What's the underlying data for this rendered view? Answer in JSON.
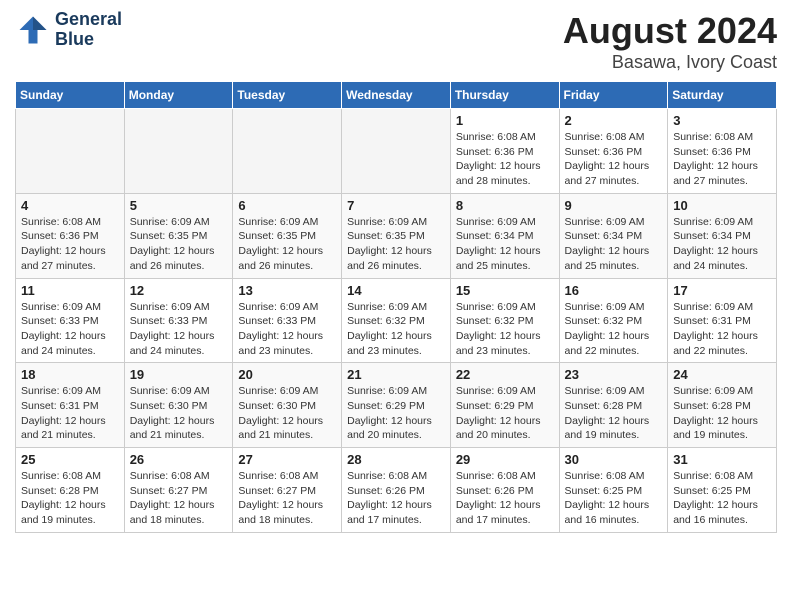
{
  "header": {
    "logo_line1": "General",
    "logo_line2": "Blue",
    "main_title": "August 2024",
    "subtitle": "Basawa, Ivory Coast"
  },
  "calendar": {
    "days_of_week": [
      "Sunday",
      "Monday",
      "Tuesday",
      "Wednesday",
      "Thursday",
      "Friday",
      "Saturday"
    ],
    "weeks": [
      [
        {
          "day": "",
          "info": ""
        },
        {
          "day": "",
          "info": ""
        },
        {
          "day": "",
          "info": ""
        },
        {
          "day": "",
          "info": ""
        },
        {
          "day": "1",
          "info": "Sunrise: 6:08 AM\nSunset: 6:36 PM\nDaylight: 12 hours\nand 28 minutes."
        },
        {
          "day": "2",
          "info": "Sunrise: 6:08 AM\nSunset: 6:36 PM\nDaylight: 12 hours\nand 27 minutes."
        },
        {
          "day": "3",
          "info": "Sunrise: 6:08 AM\nSunset: 6:36 PM\nDaylight: 12 hours\nand 27 minutes."
        }
      ],
      [
        {
          "day": "4",
          "info": "Sunrise: 6:08 AM\nSunset: 6:36 PM\nDaylight: 12 hours\nand 27 minutes."
        },
        {
          "day": "5",
          "info": "Sunrise: 6:09 AM\nSunset: 6:35 PM\nDaylight: 12 hours\nand 26 minutes."
        },
        {
          "day": "6",
          "info": "Sunrise: 6:09 AM\nSunset: 6:35 PM\nDaylight: 12 hours\nand 26 minutes."
        },
        {
          "day": "7",
          "info": "Sunrise: 6:09 AM\nSunset: 6:35 PM\nDaylight: 12 hours\nand 26 minutes."
        },
        {
          "day": "8",
          "info": "Sunrise: 6:09 AM\nSunset: 6:34 PM\nDaylight: 12 hours\nand 25 minutes."
        },
        {
          "day": "9",
          "info": "Sunrise: 6:09 AM\nSunset: 6:34 PM\nDaylight: 12 hours\nand 25 minutes."
        },
        {
          "day": "10",
          "info": "Sunrise: 6:09 AM\nSunset: 6:34 PM\nDaylight: 12 hours\nand 24 minutes."
        }
      ],
      [
        {
          "day": "11",
          "info": "Sunrise: 6:09 AM\nSunset: 6:33 PM\nDaylight: 12 hours\nand 24 minutes."
        },
        {
          "day": "12",
          "info": "Sunrise: 6:09 AM\nSunset: 6:33 PM\nDaylight: 12 hours\nand 24 minutes."
        },
        {
          "day": "13",
          "info": "Sunrise: 6:09 AM\nSunset: 6:33 PM\nDaylight: 12 hours\nand 23 minutes."
        },
        {
          "day": "14",
          "info": "Sunrise: 6:09 AM\nSunset: 6:32 PM\nDaylight: 12 hours\nand 23 minutes."
        },
        {
          "day": "15",
          "info": "Sunrise: 6:09 AM\nSunset: 6:32 PM\nDaylight: 12 hours\nand 23 minutes."
        },
        {
          "day": "16",
          "info": "Sunrise: 6:09 AM\nSunset: 6:32 PM\nDaylight: 12 hours\nand 22 minutes."
        },
        {
          "day": "17",
          "info": "Sunrise: 6:09 AM\nSunset: 6:31 PM\nDaylight: 12 hours\nand 22 minutes."
        }
      ],
      [
        {
          "day": "18",
          "info": "Sunrise: 6:09 AM\nSunset: 6:31 PM\nDaylight: 12 hours\nand 21 minutes."
        },
        {
          "day": "19",
          "info": "Sunrise: 6:09 AM\nSunset: 6:30 PM\nDaylight: 12 hours\nand 21 minutes."
        },
        {
          "day": "20",
          "info": "Sunrise: 6:09 AM\nSunset: 6:30 PM\nDaylight: 12 hours\nand 21 minutes."
        },
        {
          "day": "21",
          "info": "Sunrise: 6:09 AM\nSunset: 6:29 PM\nDaylight: 12 hours\nand 20 minutes."
        },
        {
          "day": "22",
          "info": "Sunrise: 6:09 AM\nSunset: 6:29 PM\nDaylight: 12 hours\nand 20 minutes."
        },
        {
          "day": "23",
          "info": "Sunrise: 6:09 AM\nSunset: 6:28 PM\nDaylight: 12 hours\nand 19 minutes."
        },
        {
          "day": "24",
          "info": "Sunrise: 6:09 AM\nSunset: 6:28 PM\nDaylight: 12 hours\nand 19 minutes."
        }
      ],
      [
        {
          "day": "25",
          "info": "Sunrise: 6:08 AM\nSunset: 6:28 PM\nDaylight: 12 hours\nand 19 minutes."
        },
        {
          "day": "26",
          "info": "Sunrise: 6:08 AM\nSunset: 6:27 PM\nDaylight: 12 hours\nand 18 minutes."
        },
        {
          "day": "27",
          "info": "Sunrise: 6:08 AM\nSunset: 6:27 PM\nDaylight: 12 hours\nand 18 minutes."
        },
        {
          "day": "28",
          "info": "Sunrise: 6:08 AM\nSunset: 6:26 PM\nDaylight: 12 hours\nand 17 minutes."
        },
        {
          "day": "29",
          "info": "Sunrise: 6:08 AM\nSunset: 6:26 PM\nDaylight: 12 hours\nand 17 minutes."
        },
        {
          "day": "30",
          "info": "Sunrise: 6:08 AM\nSunset: 6:25 PM\nDaylight: 12 hours\nand 16 minutes."
        },
        {
          "day": "31",
          "info": "Sunrise: 6:08 AM\nSunset: 6:25 PM\nDaylight: 12 hours\nand 16 minutes."
        }
      ]
    ]
  }
}
